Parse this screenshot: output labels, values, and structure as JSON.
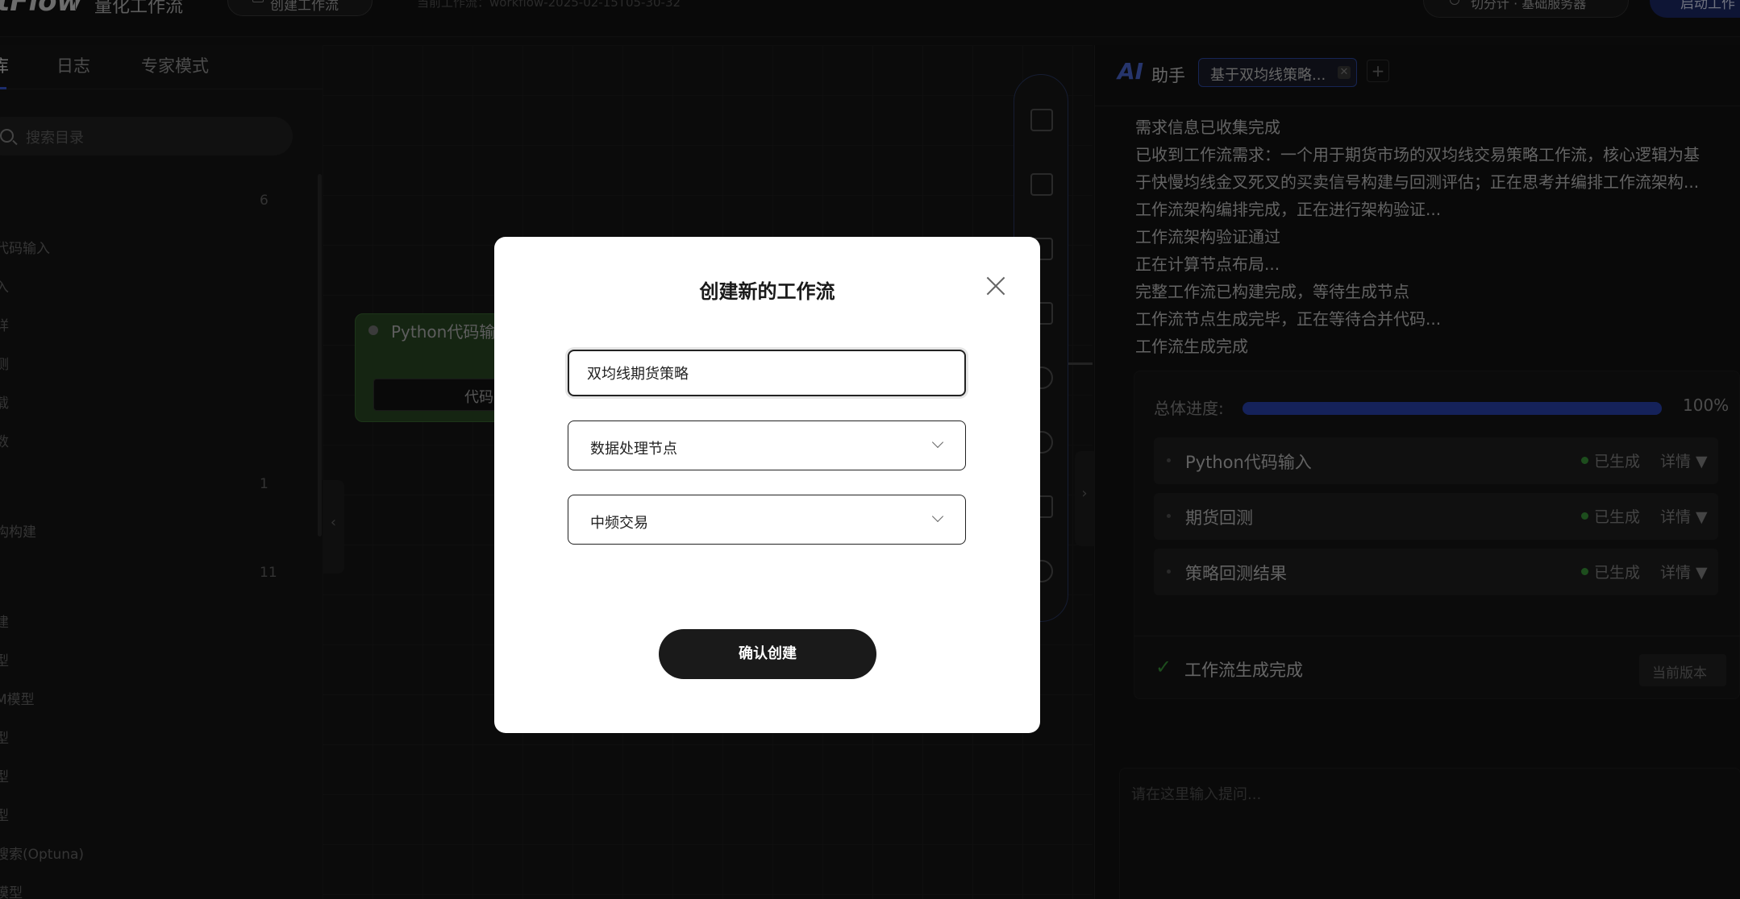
{
  "topbar": {
    "logo": "tFlow",
    "app_title": "量化工作流",
    "create_button": "创建工作流",
    "current_workflow": "当前工作流：workflow-2025-02-15T05-30-32",
    "server_button": "切分计 · 基础服务器",
    "start_button": "启动工作"
  },
  "sidebar": {
    "tabs": [
      "库",
      "日志",
      "专家模式"
    ],
    "search_placeholder": "搜索目录",
    "categories": [
      {
        "label": "",
        "count": "6"
      },
      {
        "label": "代码输入",
        "count": ""
      },
      {
        "label": "入",
        "count": ""
      },
      {
        "label": "详",
        "count": ""
      },
      {
        "label": "测",
        "count": ""
      },
      {
        "label": "载",
        "count": ""
      },
      {
        "label": "数",
        "count": ""
      },
      {
        "label": "",
        "count": "1"
      },
      {
        "label": "构构建",
        "count": ""
      },
      {
        "label": "",
        "count": "11"
      },
      {
        "label": "建",
        "count": ""
      },
      {
        "label": "型",
        "count": ""
      },
      {
        "label": "M模型",
        "count": ""
      },
      {
        "label": "型",
        "count": ""
      },
      {
        "label": "型",
        "count": ""
      },
      {
        "label": "型",
        "count": ""
      },
      {
        "label": "搜索(Optuna)",
        "count": ""
      },
      {
        "label": "模型",
        "count": ""
      }
    ]
  },
  "canvas": {
    "node_title": "Python代码输入",
    "node_body": "代码"
  },
  "ai_panel": {
    "logo": "AI",
    "label": "助手",
    "tab_label": "基于双均线策略...",
    "tab_close": "✕",
    "add_tab": "+",
    "log_lines": [
      "需求信息已收集完成",
      "已收到工作流需求：一个用于期货市场的双均线交易策略工作流，核心逻辑为基",
      "于快慢均线金叉死叉的买卖信号构建与回测评估；正在思考并编排工作流架构...",
      "工作流架构编排完成，正在进行架构验证...",
      "工作流架构验证通过",
      "正在计算节点布局...",
      "完整工作流已构建完成，等待生成节点",
      "工作流节点生成完毕，正在等待合并代码...",
      "工作流生成完成"
    ],
    "progress_label": "总体进度:",
    "progress_value": 100,
    "progress_text": "100%",
    "steps": [
      {
        "name": "Python代码输入",
        "status": "已生成",
        "detail": "详情 ▼"
      },
      {
        "name": "期货回测",
        "status": "已生成",
        "detail": "详情 ▼"
      },
      {
        "name": "策略回测结果",
        "status": "已生成",
        "detail": "详情 ▼"
      }
    ],
    "done_check": "✓",
    "done_text": "工作流生成完成",
    "version_button": "当前版本",
    "input_placeholder": "请在这里输入提问..."
  },
  "modal": {
    "title": "创建新的工作流",
    "name_value": "双均线期货策略",
    "select1_value": "数据处理节点",
    "select2_value": "中频交易",
    "confirm_label": "确认创建"
  },
  "colors": {
    "accent": "#2a44b4",
    "success": "#3b9b3b",
    "node_green": "#2a4a24"
  }
}
